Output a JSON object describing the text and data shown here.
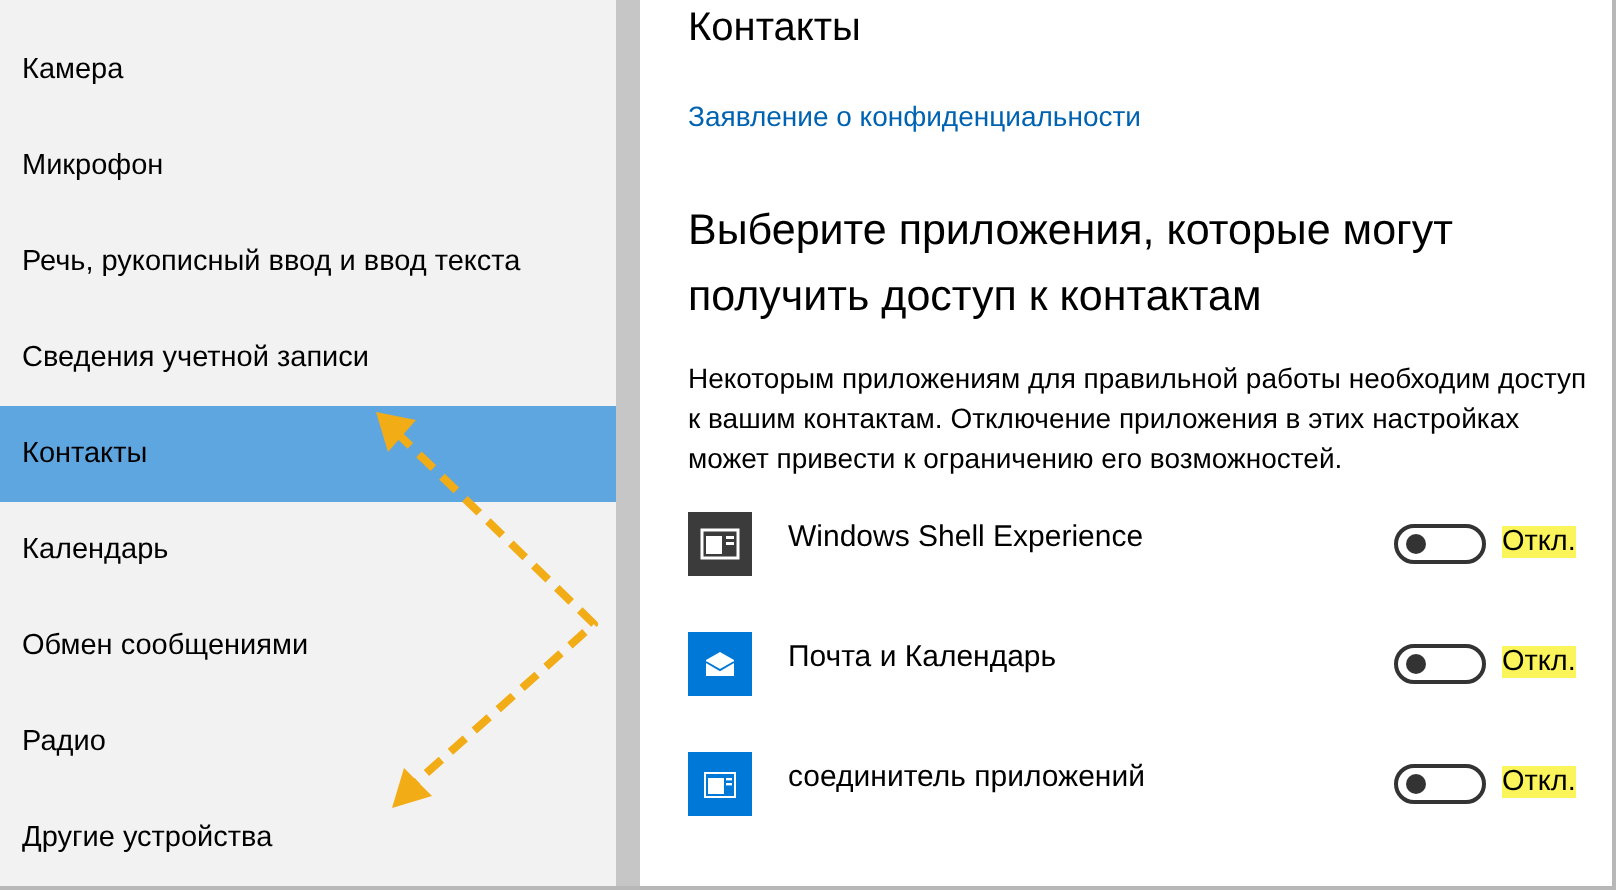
{
  "sidebar": {
    "items": [
      {
        "label": "Камера",
        "selected": false
      },
      {
        "label": "Микрофон",
        "selected": false
      },
      {
        "label": "Речь, рукописный ввод и ввод текста",
        "selected": false
      },
      {
        "label": "Сведения учетной записи",
        "selected": false
      },
      {
        "label": "Контакты",
        "selected": true
      },
      {
        "label": "Календарь",
        "selected": false
      },
      {
        "label": "Обмен сообщениями",
        "selected": false
      },
      {
        "label": "Радио",
        "selected": false
      },
      {
        "label": "Другие устройства",
        "selected": false
      }
    ]
  },
  "content": {
    "title": "Контакты",
    "privacy_link": "Заявление о конфиденциальности",
    "heading": "Выберите приложения, которые могут получить доступ к контактам",
    "description": "Некоторым приложениям для правильной работы необходим доступ к вашим контактам. Отключение приложения в этих настройках может привести к ограничению его возможностей.",
    "apps": [
      {
        "kind": "shell",
        "name": "Windows Shell Experience",
        "on": false,
        "state_label": "Откл."
      },
      {
        "kind": "mail",
        "name": "Почта и Календарь",
        "on": false,
        "state_label": "Откл."
      },
      {
        "kind": "connector",
        "name": "соединитель приложений",
        "on": false,
        "state_label": "Откл."
      }
    ]
  }
}
